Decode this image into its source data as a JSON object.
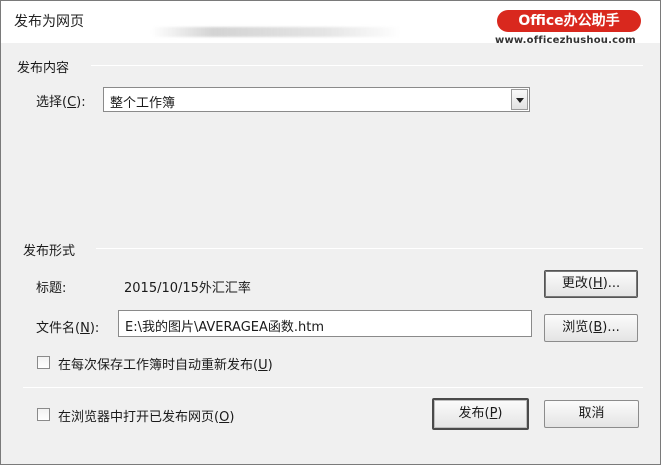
{
  "window": {
    "title": "发布为网页"
  },
  "watermark": {
    "logo_text": "Office办公助手",
    "url": "www.officezhushou.com"
  },
  "publish_content": {
    "section_title": "发布内容",
    "select_label_pre": "选择(",
    "select_label_key": "C",
    "select_label_post": "):",
    "select_value": "整个工作簿"
  },
  "publish_format": {
    "section_title": "发布形式",
    "title_label": "标题:",
    "title_value": "2015/10/15外汇汇率",
    "change_button_pre": "更改(",
    "change_button_key": "H",
    "change_button_post": ")...",
    "filename_label_pre": "文件名(",
    "filename_label_key": "N",
    "filename_label_post": "):",
    "filename_value": "E:\\我的图片\\AVERAGEA函数.htm",
    "browse_button_pre": "浏览(",
    "browse_button_key": "B",
    "browse_button_post": ")...",
    "autorepublish_pre": "在每次保存工作簿时自动重新发布(",
    "autorepublish_key": "U",
    "autorepublish_post": ")",
    "autorepublish_checked": false
  },
  "footer": {
    "open_in_browser_pre": "在浏览器中打开已发布网页(",
    "open_in_browser_key": "O",
    "open_in_browser_post": ")",
    "open_in_browser_checked": false,
    "publish_button_pre": "发布(",
    "publish_button_key": "P",
    "publish_button_post": ")",
    "cancel_button": "取消"
  }
}
